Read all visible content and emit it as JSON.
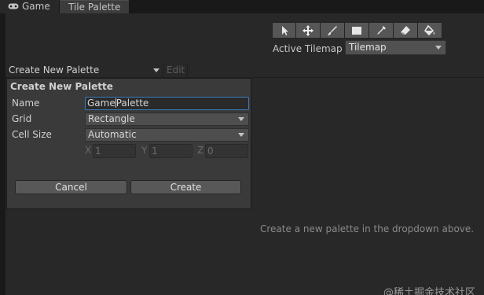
{
  "tabs": [
    {
      "label": "Game",
      "icon": "gamepad-icon"
    },
    {
      "label": "Tile Palette"
    }
  ],
  "toolbar": {
    "tools": [
      {
        "name": "select-tool",
        "icon": "cursor-arrow-icon"
      },
      {
        "name": "move-tool",
        "icon": "move-arrows-icon"
      },
      {
        "name": "paint-tool",
        "icon": "brush-icon"
      },
      {
        "name": "box-fill-tool",
        "icon": "box-icon"
      },
      {
        "name": "pick-tool",
        "icon": "eyedropper-icon"
      },
      {
        "name": "erase-tool",
        "icon": "eraser-icon"
      },
      {
        "name": "fill-tool",
        "icon": "paint-bucket-icon"
      }
    ],
    "active_tilemap_label": "Active Tilemap",
    "active_tilemap_value": "Tilemap"
  },
  "palette_bar": {
    "selected": "Create New Palette",
    "edit_label": "Edit"
  },
  "dialog": {
    "title": "Create New Palette",
    "name_label": "Name",
    "name_value_before_cursor": "Game",
    "name_value_after_cursor": "Palette",
    "grid_label": "Grid",
    "grid_value": "Rectangle",
    "cell_size_label": "Cell Size",
    "cell_size_value": "Automatic",
    "x_label": "X",
    "x_value": "1",
    "y_label": "Y",
    "y_value": "1",
    "z_label": "Z",
    "z_value": "0",
    "cancel_label": "Cancel",
    "create_label": "Create"
  },
  "hint_text": "Create a new palette in the dropdown above.",
  "watermark": "@稀土掘金技术社区"
}
